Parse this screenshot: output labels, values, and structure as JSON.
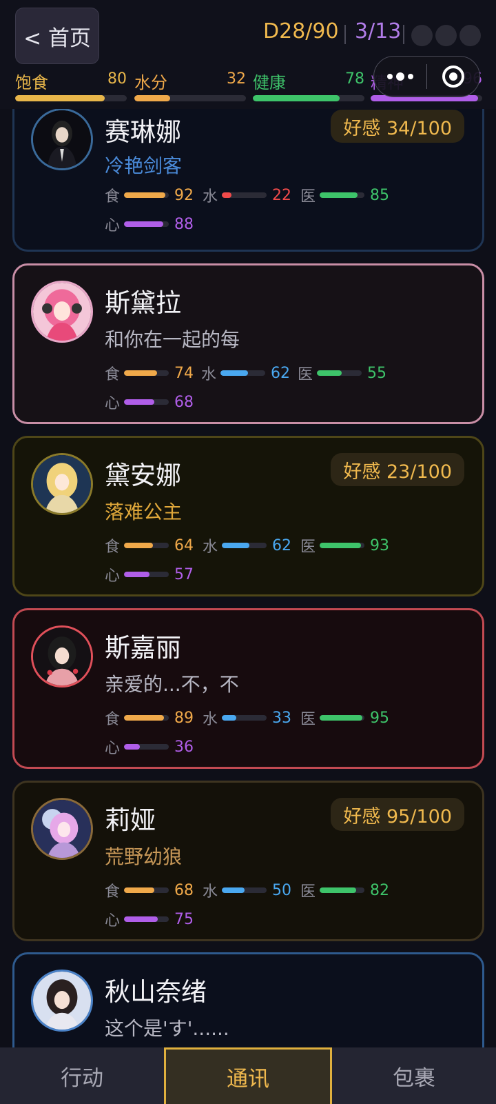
{
  "header": {
    "home_label": "< 首页",
    "day": "D28/90",
    "progress": "3/13",
    "stats": [
      {
        "label": "饱食",
        "value": "80",
        "percent": 80,
        "color": "#e8b64a"
      },
      {
        "label": "水分",
        "value": "32",
        "percent": 32,
        "color": "#f0a94a"
      },
      {
        "label": "健康",
        "value": "78",
        "percent": 78,
        "color": "#3ec46a"
      },
      {
        "label": "精神",
        "value": "96",
        "percent": 96,
        "color": "#b05ee8"
      }
    ]
  },
  "cards": [
    {
      "name": "赛琳娜",
      "sub": "冷艳剑客",
      "favor": "好感 34/100",
      "food": "92",
      "water": "22",
      "med": "85",
      "heart": "88"
    },
    {
      "name": "斯黛拉",
      "sub": "和你在一起的每",
      "food": "74",
      "water": "62",
      "med": "55",
      "heart": "68"
    },
    {
      "name": "黛安娜",
      "sub": "落难公主",
      "favor": "好感 23/100",
      "food": "64",
      "water": "62",
      "med": "93",
      "heart": "57"
    },
    {
      "name": "斯嘉丽",
      "sub": "亲爱的...不，不",
      "food": "89",
      "water": "33",
      "med": "95",
      "heart": "36"
    },
    {
      "name": "莉娅",
      "sub": "荒野幼狼",
      "favor": "好感 95/100",
      "food": "68",
      "water": "50",
      "med": "82",
      "heart": "75"
    },
    {
      "name": "秋山奈绪",
      "sub": "这个是'す'......"
    }
  ],
  "bar_keys": {
    "food": "食",
    "water": "水",
    "med": "医",
    "heart": "心"
  },
  "nav": {
    "action": "行动",
    "comm": "通讯",
    "bag": "包裹"
  }
}
